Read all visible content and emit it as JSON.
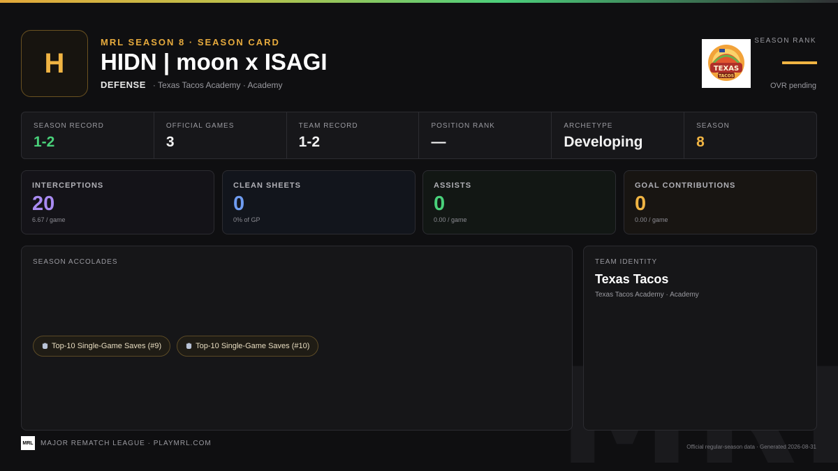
{
  "header": {
    "avatar_letter": "H",
    "eyebrow": "MRL SEASON 8 · SEASON CARD",
    "player_name": "HIDN | moon x ISAGI",
    "position": "DEFENSE",
    "team_line": "· Texas Tacos Academy · Academy",
    "logo_text": "TEXAS TACOS",
    "rank_label": "SEASON RANK",
    "ovr": "OVR pending"
  },
  "strip": [
    {
      "label": "SEASON RECORD",
      "value": "1-2",
      "tone": "green"
    },
    {
      "label": "OFFICIAL GAMES",
      "value": "3",
      "tone": "plain"
    },
    {
      "label": "TEAM RECORD",
      "value": "1-2",
      "tone": "plain"
    },
    {
      "label": "POSITION RANK",
      "value": "—",
      "tone": "plain"
    },
    {
      "label": "ARCHETYPE",
      "value": "Developing",
      "tone": "plain"
    },
    {
      "label": "SEASON",
      "value": "8",
      "tone": "amber"
    }
  ],
  "cards": [
    {
      "label": "INTERCEPTIONS",
      "value": "20",
      "sub": "6.67 / game",
      "color": "#a98bf2",
      "bg": "#141318"
    },
    {
      "label": "CLEAN SHEETS",
      "value": "0",
      "sub": "0% of GP",
      "color": "#6f9cf0",
      "bg": "#12151c"
    },
    {
      "label": "ASSISTS",
      "value": "0",
      "sub": "0.00 / game",
      "color": "#49d17a",
      "bg": "#121714"
    },
    {
      "label": "GOAL CONTRIBUTIONS",
      "value": "0",
      "sub": "0.00 / game",
      "color": "#f0b443",
      "bg": "#181512"
    }
  ],
  "accolades": {
    "label": "SEASON ACCOLADES",
    "badges": [
      {
        "icon": "glove-icon",
        "text": "Top-10 Single-Game Saves (#9)"
      },
      {
        "icon": "glove-icon",
        "text": "Top-10 Single-Game Saves (#10)"
      }
    ]
  },
  "identity": {
    "label": "TEAM IDENTITY",
    "name": "Texas Tacos",
    "sub": "Texas Tacos Academy · Academy"
  },
  "footer": {
    "logo": "MRL",
    "text": "MAJOR REMATCH LEAGUE · PLAYMRL.COM",
    "right": "Official regular-season data · Generated 2026-08-31"
  },
  "watermark": "MRL",
  "colors": {
    "accent": "#f0b443",
    "green": "#49d17a",
    "purple": "#a98bf2",
    "blue": "#6f9cf0"
  }
}
